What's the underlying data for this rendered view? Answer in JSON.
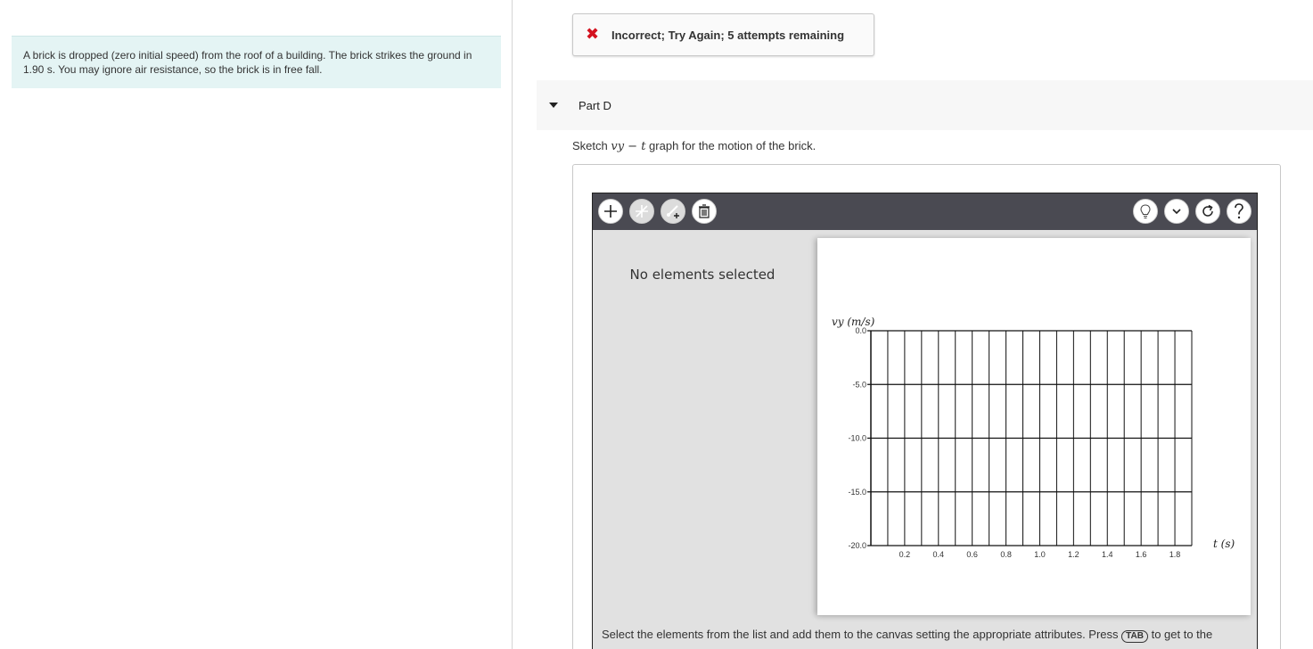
{
  "intro": {
    "text": "A brick is dropped (zero initial speed) from the roof of a building. The brick strikes the ground in 1.90 s. You may ignore air resistance, so the brick is in free fall."
  },
  "feedback": {
    "icon": "x-icon",
    "icon_color": "#d4121f",
    "message": "Incorrect; Try Again; 5 attempts remaining"
  },
  "part": {
    "title": "Part D",
    "question_pre": "Sketch ",
    "question_math": "vy − t",
    "question_post": " graph for the motion of the brick."
  },
  "tool": {
    "toolbar_left_icons": [
      "add-icon",
      "slash-icon",
      "add-point-icon",
      "trash-icon"
    ],
    "toolbar_right_icons": [
      "lightbulb-icon",
      "chevron-down-icon",
      "reset-icon",
      "help-icon"
    ],
    "selection_status": "No elements selected",
    "instruction_pre": "Select the elements from the list and add them to the canvas setting the appropriate attributes. Press ",
    "instruction_key": "TAB",
    "instruction_post": " to get to the"
  },
  "chart_data": {
    "type": "line",
    "title": "",
    "xlabel": "t (s)",
    "ylabel": "vy (m/s)",
    "x_ticks": [
      "0.2",
      "0.4",
      "0.6",
      "0.8",
      "1.0",
      "1.2",
      "1.4",
      "1.6",
      "1.8"
    ],
    "y_ticks": [
      "0.0",
      "-5.0",
      "-10.0",
      "-15.0",
      "-20.0"
    ],
    "xlim": [
      0,
      1.9
    ],
    "ylim": [
      -20,
      0
    ],
    "x_grid_step": 0.1,
    "grid": true,
    "series": []
  }
}
